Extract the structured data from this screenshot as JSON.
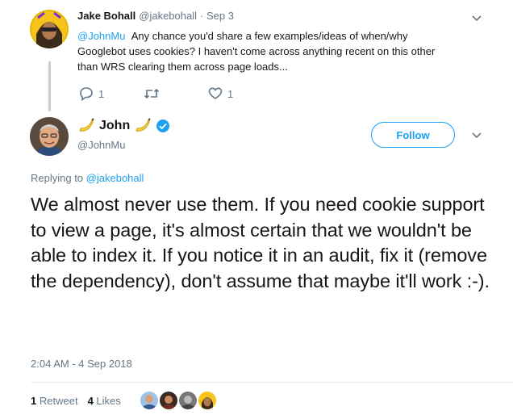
{
  "reply_tweet": {
    "author_name": "Jake Bohall",
    "author_handle": "@jakebohall",
    "time": "· Sep 3",
    "mention": "@JohnMu",
    "text_line1": "Any chance you'd share a few examples/ideas of when/why",
    "text_line2": "Googlebot uses cookies? I haven't come across anything recent on this other",
    "text_line3": "than WRS clearing them across page loads...",
    "reply_count": "1",
    "like_count": "1"
  },
  "main_tweet": {
    "author_name": "John",
    "author_handle": "@JohnMu",
    "follow_label": "Follow",
    "replying_to_label": "Replying to",
    "replying_to_handle": "@jakebohall",
    "text": "We almost never use them. If you need cookie support to view a page, it's almost certain that we wouldn't be able to index it. If you notice it in an audit, fix it (remove the dependency), don't assume that maybe it'll work :-).",
    "timestamp": "2:04 AM - 4 Sep 2018",
    "retweet_count": "1",
    "retweet_label": "Retweet",
    "like_count": "4",
    "likes_label": "Likes"
  },
  "colors": {
    "accent": "#1da1f2",
    "muted": "#657786",
    "verified": "#1da1f2"
  },
  "icons": {
    "reply": "reply-icon",
    "retweet": "retweet-icon",
    "like": "heart-icon",
    "verified": "verified-badge-icon",
    "caret": "chevron-down-icon",
    "emoji": "banana-emoji-icon"
  }
}
